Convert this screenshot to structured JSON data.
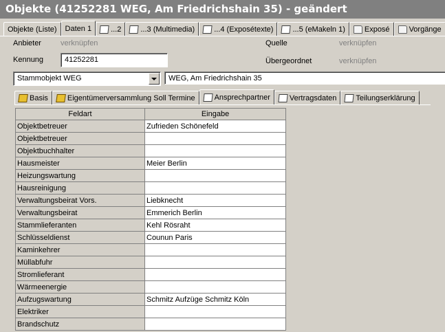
{
  "window": {
    "title": "Objekte (41252281 WEG, Am Friedrichshain 35) - geändert"
  },
  "main_tabs": [
    {
      "label": "Objekte (Liste)",
      "icon": "",
      "active": false
    },
    {
      "label": "Daten 1",
      "icon": "",
      "active": true
    },
    {
      "label": "...2",
      "icon": "page-icon",
      "active": false
    },
    {
      "label": "...3 (Multimedia)",
      "icon": "page-icon",
      "active": false
    },
    {
      "label": "...4 (Exposétexte)",
      "icon": "page-icon",
      "active": false
    },
    {
      "label": "...5 (eMakeln 1)",
      "icon": "page-icon",
      "active": false
    },
    {
      "label": "Exposé",
      "icon": "folder-icon",
      "active": false
    },
    {
      "label": "Vorgänge",
      "icon": "folder-icon",
      "active": false
    }
  ],
  "form": {
    "anbieter_label": "Anbieter",
    "anbieter_link": "verknüpfen",
    "quelle_label": "Quelle",
    "quelle_link": "verknüpfen",
    "kennung_label": "Kennung",
    "kennung_value": "41252281",
    "uebergeordnet_label": "Übergeordnet",
    "uebergeordnet_link": "verknüpfen",
    "stammobjekt_value": "Stammobjekt WEG",
    "address_value": "WEG, Am Friedrichshain 35"
  },
  "sub_tabs": [
    {
      "label": "Basis",
      "active": false
    },
    {
      "label": "Eigentümerversammlung Soll Termine",
      "active": false
    },
    {
      "label": "Ansprechpartner",
      "active": true
    },
    {
      "label": "Vertragsdaten",
      "active": false
    },
    {
      "label": "Teilungserklärung",
      "active": false
    }
  ],
  "table": {
    "headers": [
      "Feldart",
      "Eingabe"
    ],
    "rows": [
      [
        "Objektbetreuer",
        "Zufrieden Schönefeld"
      ],
      [
        "Objektbetreuer",
        ""
      ],
      [
        "Objektbuchhalter",
        ""
      ],
      [
        "Hausmeister",
        "Meier Berlin"
      ],
      [
        "Heizungswartung",
        ""
      ],
      [
        "Hausreinigung",
        ""
      ],
      [
        "Verwaltungsbeirat Vors.",
        "Liebknecht"
      ],
      [
        "Verwaltungsbeirat",
        "Emmerich Berlin"
      ],
      [
        "Stammlieferanten",
        "Kehl Rösraht"
      ],
      [
        "Schlüsseldienst",
        "Counun Paris"
      ],
      [
        "Kaminkehrer",
        ""
      ],
      [
        "Müllabfuhr",
        ""
      ],
      [
        "Stromlieferant",
        ""
      ],
      [
        "Wärmeenergie",
        ""
      ],
      [
        "Aufzugswartung",
        "Schmitz Aufzüge Schmitz Köln"
      ],
      [
        "Elektriker",
        ""
      ],
      [
        "Brandschutz",
        ""
      ]
    ]
  }
}
